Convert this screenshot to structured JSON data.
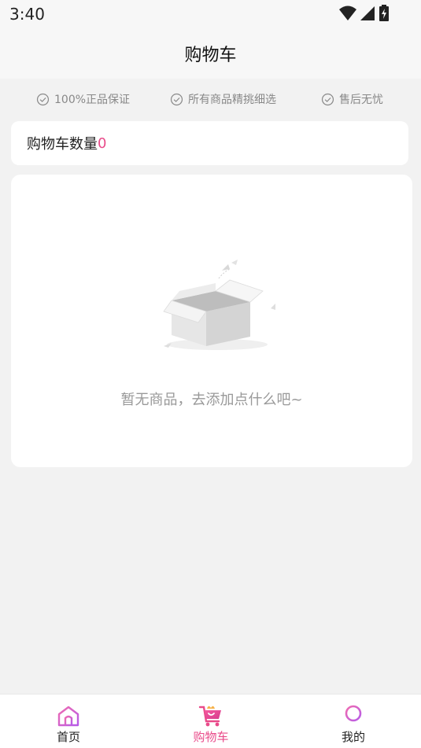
{
  "status_bar": {
    "time": "3:40",
    "icons": [
      "wifi-icon",
      "signal-icon",
      "battery-icon"
    ]
  },
  "header": {
    "title": "购物车"
  },
  "guarantees": [
    {
      "icon": "check-circle-icon",
      "label": "100%正品保证"
    },
    {
      "icon": "check-circle-icon",
      "label": "所有商品精挑细选"
    },
    {
      "icon": "check-circle-icon",
      "label": "售后无忧"
    }
  ],
  "cart_count": {
    "label": "购物车数量",
    "value": "0"
  },
  "empty_state": {
    "icon": "empty-box-icon",
    "message": "暂无商品，去添加点什么吧~"
  },
  "tabs": [
    {
      "label": "首页",
      "icon": "home-icon",
      "active": false
    },
    {
      "label": "购物车",
      "icon": "cart-icon",
      "active": true
    },
    {
      "label": "我的",
      "icon": "profile-icon",
      "active": false
    }
  ],
  "colors": {
    "accent": "#e94b8a",
    "background": "#f2f2f2",
    "card": "#ffffff",
    "muted_text": "#999999"
  }
}
